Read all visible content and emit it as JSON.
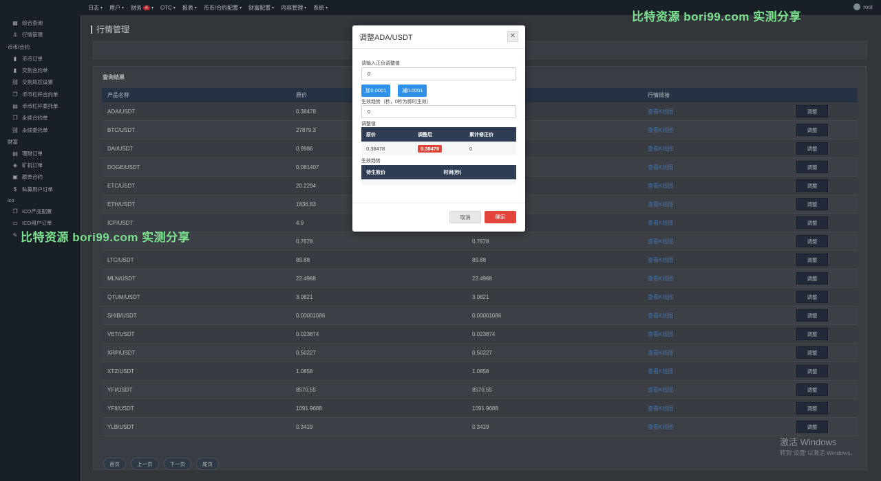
{
  "topbar": {
    "nav": [
      {
        "label": "日志"
      },
      {
        "label": "用户"
      },
      {
        "label": "财务",
        "badge": "4"
      },
      {
        "label": "OTC"
      },
      {
        "label": "报表"
      },
      {
        "label": "币币/合约配置"
      },
      {
        "label": "财富配置"
      },
      {
        "label": "内容管理"
      },
      {
        "label": "系统"
      }
    ],
    "user": "root"
  },
  "sidebar": {
    "items": [
      {
        "type": "item",
        "label": "综合查询",
        "icon": "grid-icon"
      },
      {
        "type": "item",
        "label": "行情管理",
        "icon": "anchor-icon"
      },
      {
        "type": "group",
        "label": "币币/合约"
      },
      {
        "type": "item",
        "label": "币币订单",
        "icon": "bookmark-icon"
      },
      {
        "type": "item",
        "label": "交割合约单",
        "icon": "bookmark-icon"
      },
      {
        "type": "item",
        "label": "交割风控设置",
        "icon": "link-icon"
      },
      {
        "type": "item",
        "label": "币币杠杆合约单",
        "icon": "copy-icon"
      },
      {
        "type": "item",
        "label": "币币杠杆委托单",
        "icon": "table-icon"
      },
      {
        "type": "item",
        "label": "永续合约单",
        "icon": "copy-icon"
      },
      {
        "type": "item",
        "label": "永续委托单",
        "icon": "link-icon"
      },
      {
        "type": "group",
        "label": "财富"
      },
      {
        "type": "item",
        "label": "理财订单",
        "icon": "table-icon"
      },
      {
        "type": "item",
        "label": "矿机订单",
        "icon": "layers-icon"
      },
      {
        "type": "item",
        "label": "跟单合约",
        "icon": "calendar-icon"
      },
      {
        "type": "item",
        "label": "私募用户订单",
        "icon": "dollar-icon"
      },
      {
        "type": "group",
        "label": "ico"
      },
      {
        "type": "item",
        "label": "ICO产品配置",
        "icon": "copy-icon"
      },
      {
        "type": "item",
        "label": "ICO用户订单",
        "icon": "monitor-icon"
      },
      {
        "type": "item",
        "label": "",
        "icon": "edit-icon"
      }
    ]
  },
  "page": {
    "title": "行情管理",
    "result_title": "查询结果",
    "columns": [
      "产品名称",
      "原价",
      "",
      "行情链接",
      ""
    ],
    "link_label": "查看K线图",
    "adjust_label": "调整",
    "rows": [
      {
        "name": "ADA/USDT",
        "price": "0.38478",
        "adj": ""
      },
      {
        "name": "BTC/USDT",
        "price": "27879.3",
        "adj": ""
      },
      {
        "name": "DAI/USDT",
        "price": "0.9986",
        "adj": ""
      },
      {
        "name": "DOGE/USDT",
        "price": "0.081407",
        "adj": ""
      },
      {
        "name": "ETC/USDT",
        "price": "20.2294",
        "adj": ""
      },
      {
        "name": "ETH/USDT",
        "price": "1836.83",
        "adj": ""
      },
      {
        "name": "ICP/USDT",
        "price": "4.9",
        "adj": ""
      },
      {
        "name": "",
        "price": "0.7678",
        "adj": "0.7678"
      },
      {
        "name": "LTC/USDT",
        "price": "89.88",
        "adj": "89.88"
      },
      {
        "name": "MLN/USDT",
        "price": "22.4968",
        "adj": "22.4968"
      },
      {
        "name": "QTUM/USDT",
        "price": "3.0821",
        "adj": "3.0821"
      },
      {
        "name": "SHIB/USDT",
        "price": "0.00001086",
        "adj": "0.00001086"
      },
      {
        "name": "VET/USDT",
        "price": "0.023874",
        "adj": "0.023874"
      },
      {
        "name": "XRP/USDT",
        "price": "0.50227",
        "adj": "0.50227"
      },
      {
        "name": "XTZ/USDT",
        "price": "1.0858",
        "adj": "1.0858"
      },
      {
        "name": "YFI/USDT",
        "price": "8570.55",
        "adj": "8570.55"
      },
      {
        "name": "YFII/USDT",
        "price": "1091.9688",
        "adj": "1091.9688"
      },
      {
        "name": "YLB/USDT",
        "price": "0.3419",
        "adj": "0.3419"
      }
    ],
    "pager": [
      "首页",
      "上一页",
      "下一页",
      "尾页"
    ]
  },
  "watermark": {
    "text": "比特资源 bori99.com 实测分享",
    "windows_title": "激活 Windows",
    "windows_sub": "转到\"设置\"以激活 Windows。"
  },
  "modal": {
    "title": "调整ADA/USDT",
    "close": "✕",
    "input_label": "请输入正负调整值",
    "input_value": "0",
    "add_label": "加0.0001",
    "sub_label": "减0.0001",
    "time_label": "生效趋势（秒，0秒为即时生效）",
    "time_value": "0",
    "adjust_section": "调整值",
    "adjust_headers": [
      "原价",
      "调整后",
      "累计修正价"
    ],
    "adjust_row": [
      "0.38478",
      "0.38478",
      "0"
    ],
    "trend_section": "生效趋势",
    "trend_headers": [
      "待生效价",
      "时间(秒)"
    ],
    "cancel": "取消",
    "ok": "确定"
  }
}
